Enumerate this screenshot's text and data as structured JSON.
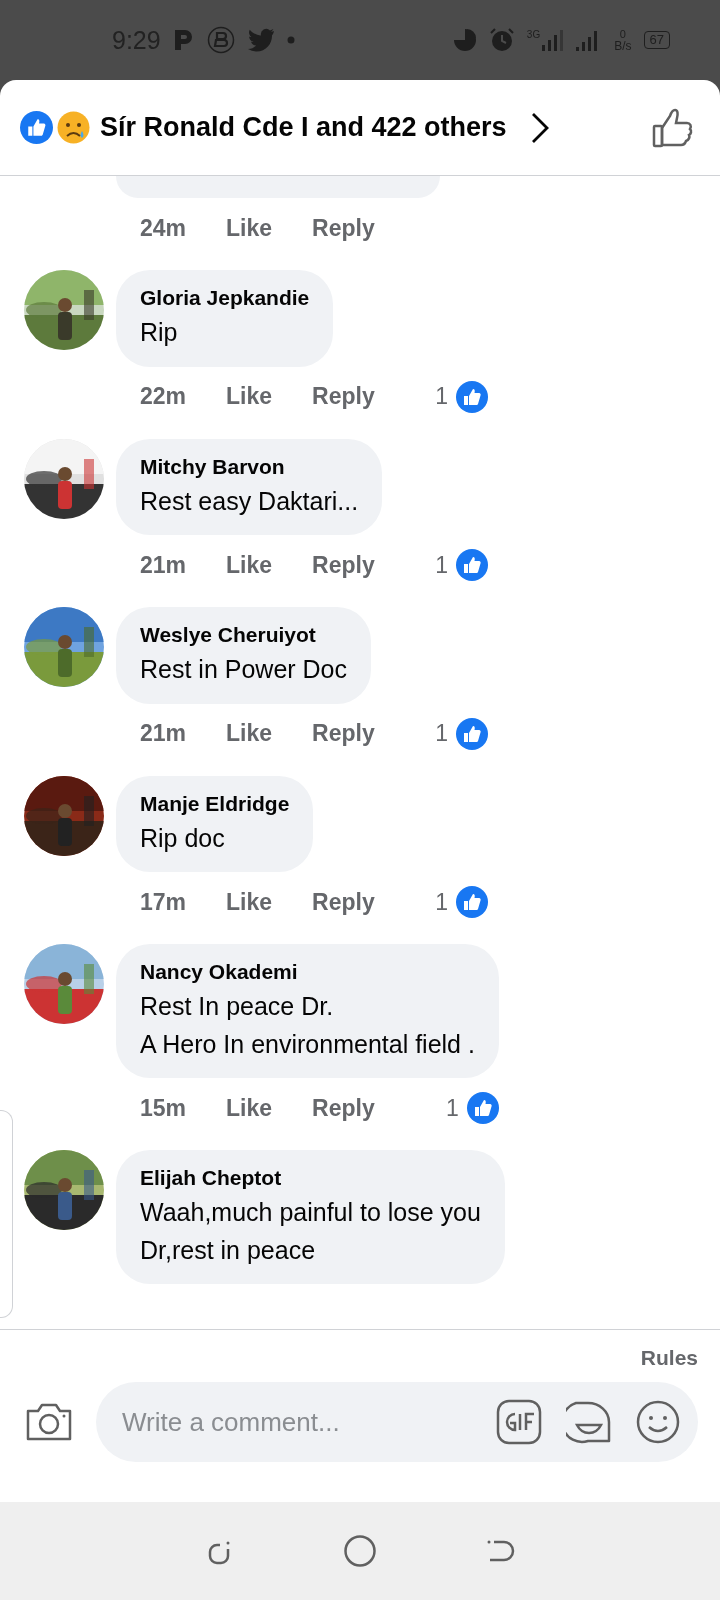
{
  "status_bar": {
    "time": "9:29",
    "network": "3G",
    "speed_value": "0",
    "speed_unit": "B/s",
    "battery": "67"
  },
  "header": {
    "title": "Sír Ronald Cde I and 422 others"
  },
  "top_comment": {
    "time": "24m",
    "like": "Like",
    "reply": "Reply"
  },
  "comments": [
    {
      "name": "Gloria Jepkandie",
      "text": "Rip",
      "time": "22m",
      "like": "Like",
      "reply": "Reply",
      "reactions": "1"
    },
    {
      "name": "Mitchy Barvon",
      "text": "Rest easy Daktari...",
      "time": "21m",
      "like": "Like",
      "reply": "Reply",
      "reactions": "1"
    },
    {
      "name": "Weslye Cheruiyot",
      "text": "Rest in Power Doc",
      "time": "21m",
      "like": "Like",
      "reply": "Reply",
      "reactions": "1"
    },
    {
      "name": "Manje Eldridge",
      "text": "Rip doc",
      "time": "17m",
      "like": "Like",
      "reply": "Reply",
      "reactions": "1"
    },
    {
      "name": "Nancy Okademi",
      "text": "Rest In peace Dr.\nA Hero In environmental field .",
      "time": "15m",
      "like": "Like",
      "reply": "Reply",
      "reactions": "1"
    },
    {
      "name": "Elijah Cheptot",
      "text": "Waah,much painful to lose you\nDr,rest in peace"
    }
  ],
  "rules_link": "Rules",
  "composer": {
    "placeholder": "Write a comment..."
  }
}
